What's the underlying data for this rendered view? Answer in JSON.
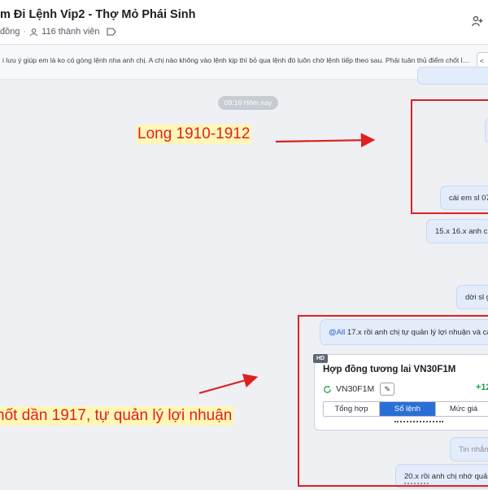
{
  "header": {
    "title": "m Đi Lệnh Vip2 - Thợ Mỏ Phái Sinh",
    "community_label": "đồng",
    "separator": "·",
    "members_label": "116 thành viên"
  },
  "pinned": {
    "text": "i lưu ý giúp em là ko có gòng lệnh nha anh chị. A chị nào không vào lệnh kịp thì bỏ qua lệnh đó luôn chờ lệnh tiếp theo sau. Phải tuân thủ điểm chốt lời ...",
    "side_label": "<"
  },
  "chat": {
    "time_divider": "09:16 Hôm nay",
    "messages": {
      "m1": "",
      "m2": "cài em sl 07",
      "m3": "15.x 16.x anh chị",
      "m4": "dời sl g",
      "m5_mention": "@All",
      "m5_text": " 17.x rồi anh chị tự quản lý lợi nhuận và cà",
      "m6": "Tin nhắn c",
      "m7": "20.x rồi anh chị nhớ quản"
    }
  },
  "card": {
    "badge": "HD",
    "title": "Hợp đồng tương lai VN30F1M",
    "symbol": "VN30F1M",
    "edit_glyph": "✎",
    "change": "+12",
    "tabs": [
      "Tổng hợp",
      "Sổ lệnh",
      "Mức giá",
      ""
    ],
    "active_tab_index": 1
  },
  "annotations": {
    "a1": "Long 1910-1912",
    "a2": "hốt dần 1917, tự quản lý lợi nhuận"
  },
  "colors": {
    "annotation_red": "#e02020",
    "highlight_yellow": "#fff6b8",
    "bubble_bg": "#e3ecfb",
    "active_tab": "#2a6fd6",
    "positive_change": "#15a34a"
  }
}
